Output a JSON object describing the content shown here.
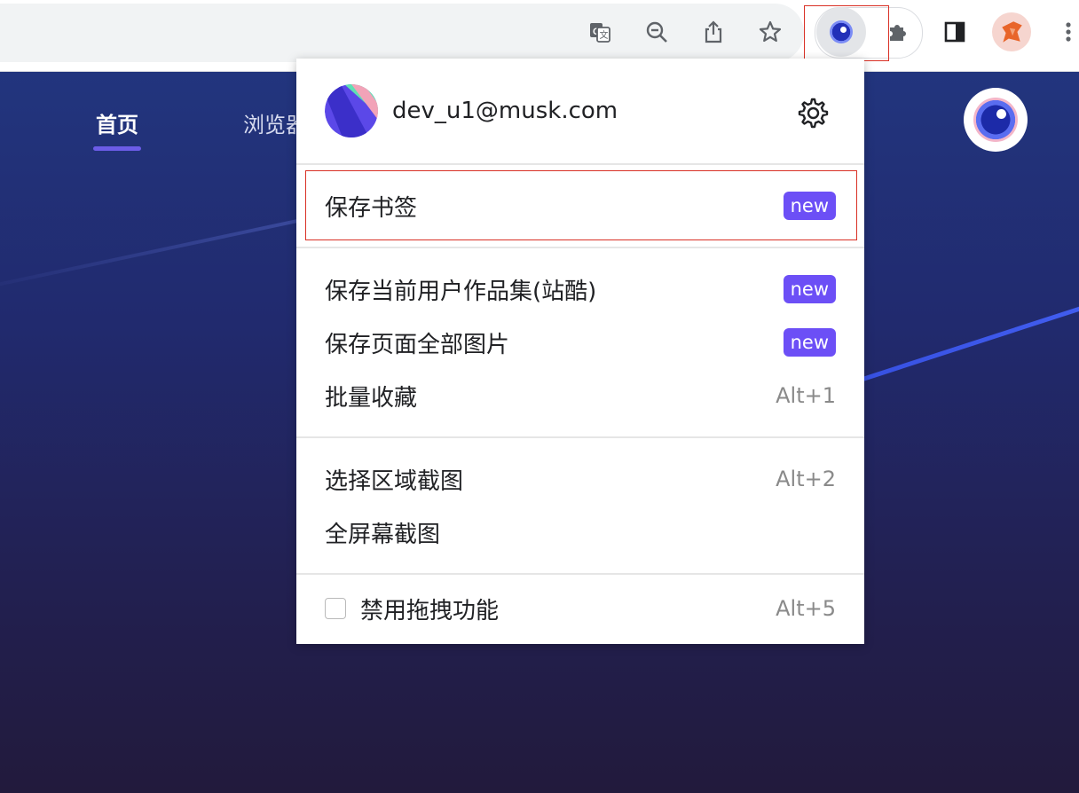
{
  "toolbar": {
    "icons": [
      "translate-icon",
      "zoom-out-icon",
      "share-icon",
      "star-icon",
      "extension-eye-icon",
      "puzzle-icon",
      "side-panel-icon",
      "profile-avatar",
      "kebab-menu-icon"
    ]
  },
  "page": {
    "nav": {
      "home": "首页",
      "browser": "浏览器"
    }
  },
  "menu": {
    "header": {
      "email": "dev_u1@musk.com"
    },
    "groups": [
      {
        "items": [
          {
            "label": "保存书签",
            "badge": "new"
          }
        ]
      },
      {
        "items": [
          {
            "label": "保存当前用户作品集(站酷)",
            "badge": "new"
          },
          {
            "label": "保存页面全部图片",
            "badge": "new"
          },
          {
            "label": "批量收藏",
            "shortcut": "Alt+1"
          }
        ]
      },
      {
        "items": [
          {
            "label": "选择区域截图",
            "shortcut": "Alt+2"
          },
          {
            "label": "全屏幕截图"
          }
        ]
      },
      {
        "items": [
          {
            "label": "禁用拖拽功能",
            "shortcut": "Alt+5",
            "checked": false
          }
        ]
      }
    ]
  },
  "colors": {
    "badge": "#6c4ff6",
    "accent": "#6c5ce7",
    "highlight": "#d93025"
  }
}
